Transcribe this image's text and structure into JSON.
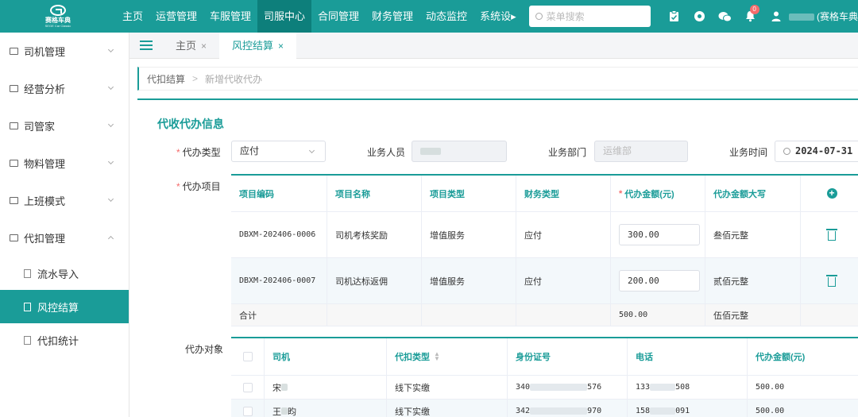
{
  "app": {
    "logo_name": "赛格车典",
    "logo_sub": "SEGE Car Classic"
  },
  "topnav": {
    "items": [
      {
        "label": "主页"
      },
      {
        "label": "运营管理"
      },
      {
        "label": "车服管理"
      },
      {
        "label": "司服中心"
      },
      {
        "label": "合同管理"
      },
      {
        "label": "财务管理"
      },
      {
        "label": "动态监控"
      },
      {
        "label": "系统设▸"
      }
    ],
    "active_index": 3,
    "search_placeholder": "菜单搜索",
    "notification_count": "0",
    "user_suffix": "(赛格车典"
  },
  "sidebar": {
    "items": [
      {
        "label": "司机管理"
      },
      {
        "label": "经营分析"
      },
      {
        "label": "司管家"
      },
      {
        "label": "物料管理"
      },
      {
        "label": "上班模式"
      },
      {
        "label": "代扣管理"
      }
    ],
    "sub_items": [
      {
        "label": "流水导入"
      },
      {
        "label": "风控结算"
      },
      {
        "label": "代扣统计"
      }
    ],
    "active_sub": 1
  },
  "tabs": [
    {
      "label": "主页",
      "close": "×"
    },
    {
      "label": "风控结算",
      "close": "×"
    }
  ],
  "breadcrumb": {
    "parent": "代扣结算",
    "separator": ">",
    "current": "新增代收代办"
  },
  "form": {
    "section_title": "代收代办信息",
    "type_label": "代办类型",
    "type_value": "应付",
    "staff_label": "业务人员",
    "dept_label": "业务部门",
    "dept_value": "运维部",
    "time_label": "业务时间",
    "time_value": "2024-07-31",
    "items_label": "代办项目",
    "target_label": "代办对象",
    "required_mark": "*"
  },
  "items_table": {
    "headers": [
      "项目编码",
      "项目名称",
      "项目类型",
      "财务类型",
      "代办金额(元)",
      "代办金额大写"
    ],
    "required_header_index": 4,
    "rows": [
      {
        "code": "DBXM-202406-0006",
        "name": "司机考核奖励",
        "type": "增值服务",
        "fin": "应付",
        "amount": "300.00",
        "upper": "叁佰元整"
      },
      {
        "code": "DBXM-202406-0007",
        "name": "司机达标返佣",
        "type": "增值服务",
        "fin": "应付",
        "amount": "200.00",
        "upper": "贰佰元整"
      }
    ],
    "total_label": "合计",
    "total_amount": "500.00",
    "total_upper": "伍佰元整"
  },
  "target_table": {
    "headers": [
      "司机",
      "代扣类型",
      "身份证号",
      "电话",
      "代办金额(元)"
    ],
    "rows": [
      {
        "driver": "宋",
        "type": "线下实缴",
        "id_start": "340",
        "id_end": "576",
        "phone_start": "133",
        "phone_end": "508",
        "amount": "500.00"
      },
      {
        "driver": "王",
        "driver_end": "昀",
        "type": "线下实缴",
        "id_start": "342",
        "id_end": "970",
        "phone_start": "158",
        "phone_end": "091",
        "amount": "500.00"
      }
    ]
  },
  "colors": {
    "primary": "#1a9c98",
    "primary_dark": "#0d7f7b",
    "danger": "#f56c6c"
  }
}
